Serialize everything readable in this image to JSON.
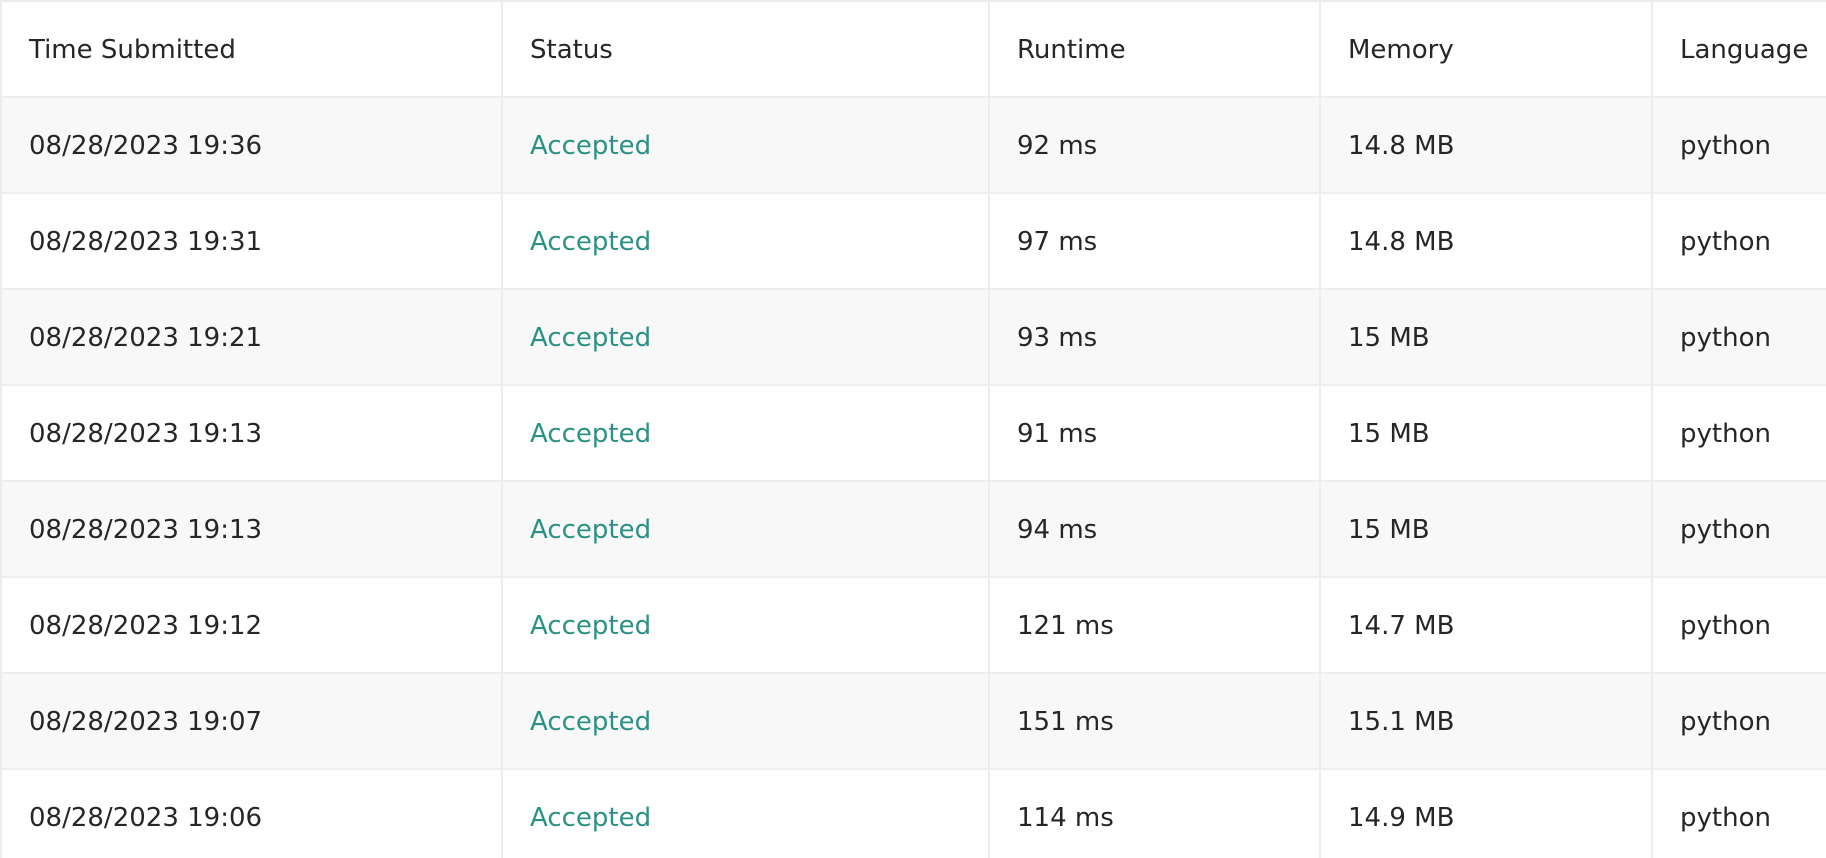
{
  "colors": {
    "accepted": "#2a9184",
    "text": "#262626",
    "stripe": "#f8f8f8",
    "border": "#ececec"
  },
  "columns": [
    "Time Submitted",
    "Status",
    "Runtime",
    "Memory",
    "Language"
  ],
  "rows": [
    {
      "time": "08/28/2023 19:36",
      "status": "Accepted",
      "runtime": "92 ms",
      "memory": "14.8 MB",
      "language": "python"
    },
    {
      "time": "08/28/2023 19:31",
      "status": "Accepted",
      "runtime": "97 ms",
      "memory": "14.8 MB",
      "language": "python"
    },
    {
      "time": "08/28/2023 19:21",
      "status": "Accepted",
      "runtime": "93 ms",
      "memory": "15 MB",
      "language": "python"
    },
    {
      "time": "08/28/2023 19:13",
      "status": "Accepted",
      "runtime": "91 ms",
      "memory": "15 MB",
      "language": "python"
    },
    {
      "time": "08/28/2023 19:13",
      "status": "Accepted",
      "runtime": "94 ms",
      "memory": "15 MB",
      "language": "python"
    },
    {
      "time": "08/28/2023 19:12",
      "status": "Accepted",
      "runtime": "121 ms",
      "memory": "14.7 MB",
      "language": "python"
    },
    {
      "time": "08/28/2023 19:07",
      "status": "Accepted",
      "runtime": "151 ms",
      "memory": "15.1 MB",
      "language": "python"
    },
    {
      "time": "08/28/2023 19:06",
      "status": "Accepted",
      "runtime": "114 ms",
      "memory": "14.9 MB",
      "language": "python"
    }
  ]
}
